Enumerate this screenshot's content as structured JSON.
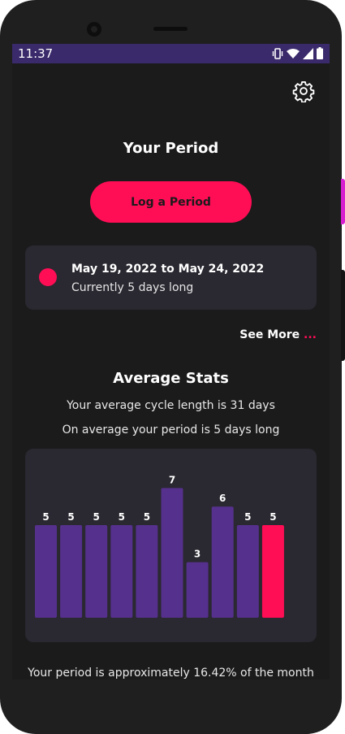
{
  "status_bar": {
    "time": "11:37"
  },
  "header": {
    "title": "Your Period",
    "log_button_label": "Log a Period"
  },
  "current_period": {
    "range": "May 19, 2022 to May 24, 2022",
    "length_text": "Currently 5 days long"
  },
  "see_more": {
    "label": "See More",
    "dots": "..."
  },
  "average_stats": {
    "title": "Average Stats",
    "cycle_text": "Your average cycle length is 31 days",
    "period_text": "On average your period is 5 days long"
  },
  "chart_data": {
    "type": "bar",
    "values": [
      5,
      5,
      5,
      5,
      5,
      7,
      3,
      6,
      5,
      5
    ],
    "bar_color": "#55308d",
    "highlight_color": "#ff0d55",
    "highlight_index": 9
  },
  "footer": {
    "text": "Your period is approximately 16.42% of the month"
  },
  "colors": {
    "accent": "#ff0d55",
    "status_bar": "#3a2a6b",
    "card": "#2a2830",
    "background": "#1b1b1c"
  },
  "icons": [
    "settings-gear-icon",
    "vibrate-icon",
    "wifi-icon",
    "signal-icon",
    "battery-icon"
  ]
}
